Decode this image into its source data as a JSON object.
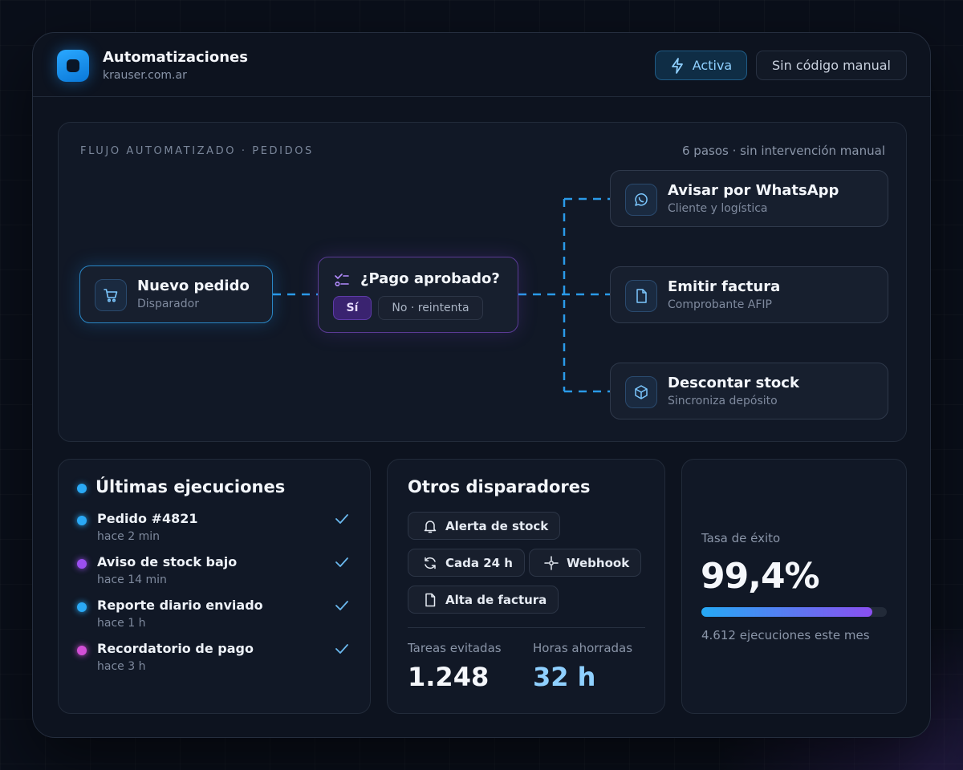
{
  "header": {
    "title": "Automatizaciones",
    "subtitle": "krauser.com.ar",
    "active_label": "Activa",
    "manual_label": "Sin código manual"
  },
  "flow": {
    "label": "FLUJO AUTOMATIZADO · PEDIDOS",
    "meta": "6 pasos · sin intervención manual",
    "trigger": {
      "title": "Nuevo pedido",
      "subtitle": "Disparador",
      "icon": "cart-icon"
    },
    "decision": {
      "title": "¿Pago aprobado?",
      "yes": "Sí",
      "no": "No · reintenta",
      "icon": "branch-icon"
    },
    "outputs": [
      {
        "title": "Avisar por WhatsApp",
        "subtitle": "Cliente y logística",
        "icon": "whatsapp-icon"
      },
      {
        "title": "Emitir factura",
        "subtitle": "Comprobante AFIP",
        "icon": "document-icon"
      },
      {
        "title": "Descontar stock",
        "subtitle": "Sincroniza depósito",
        "icon": "box-icon"
      }
    ]
  },
  "executions": {
    "title": "Últimas ejecuciones",
    "items": [
      {
        "name": "Pedido #4821",
        "time": "hace 2 min",
        "color": "#2aa9f5"
      },
      {
        "name": "Aviso de stock bajo",
        "time": "hace 14 min",
        "color": "#9b4ff0"
      },
      {
        "name": "Reporte diario enviado",
        "time": "hace 1 h",
        "color": "#2aa9f5"
      },
      {
        "name": "Recordatorio de pago",
        "time": "hace 3 h",
        "color": "#d24fd6"
      }
    ]
  },
  "triggers": {
    "title": "Otros disparadores",
    "chips": [
      {
        "label": "Alerta de stock",
        "icon": "bell-icon"
      },
      {
        "label": "Cada 24 h",
        "icon": "refresh-icon"
      },
      {
        "label": "Webhook",
        "icon": "webhook-icon"
      },
      {
        "label": "Alta de factura",
        "icon": "document-icon"
      }
    ],
    "stats": [
      {
        "label": "Tareas evitadas",
        "value": "1.248"
      },
      {
        "label": "Horas ahorradas",
        "value": "32 h"
      }
    ]
  },
  "success": {
    "label": "Tasa de éxito",
    "value": "99,4%",
    "fraction": 0.92,
    "note": "4.612 ejecuciones este mes"
  },
  "colors": {
    "accent_blue": "#2aa9f5",
    "accent_purple": "#8a4ff0",
    "stat_blue": "#8fd0ff"
  }
}
